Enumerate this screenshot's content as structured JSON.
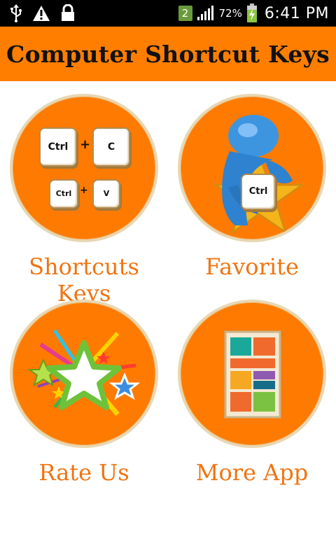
{
  "status_bar": {
    "sim_slot": "2",
    "battery_percent": "72%",
    "time": "6:41 PM",
    "icons": [
      "usb-icon",
      "warning-icon",
      "lock-icon",
      "signal-icon",
      "battery-charging-icon"
    ]
  },
  "app_bar": {
    "title": "Computer Shortcut Keys",
    "background_color": "#ff7e00"
  },
  "menu": {
    "accent_color": "#ef7412",
    "items": [
      {
        "label": "Shortcuts Keys",
        "icon": "keyboard-shortcut-icon",
        "keys": {
          "k1": "Ctrl",
          "k2": "C",
          "k3": "Ctrl",
          "k4": "V",
          "plus1": "+",
          "plus2": "+"
        }
      },
      {
        "label": "Favorite",
        "icon": "favorite-star-figure-icon",
        "key": "Ctrl"
      },
      {
        "label": "Rate Us",
        "icon": "rate-stars-icon"
      },
      {
        "label": "More App",
        "icon": "app-tiles-icon"
      }
    ]
  }
}
